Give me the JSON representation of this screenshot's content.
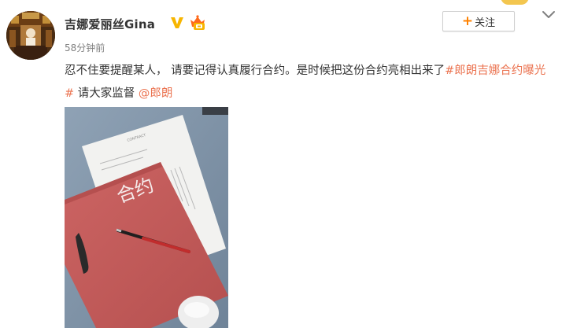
{
  "post": {
    "author": "吉娜爱丽丝Gina",
    "time": "58分钟前",
    "follow_label": "关注",
    "follow_plus": "+",
    "text_before": "忍不住要提醒某人，  请要记得认真履行合约。是时候把这份合约亮相出来了",
    "hashtag": "#郎朗吉娜合约曝光#",
    "text_middle": "  请大家监督  ",
    "mention": "@郎朗"
  },
  "image": {
    "folder_text": "合约",
    "paper_heading": "CONTRACT"
  },
  "icons": {
    "verified": "verified-v-icon",
    "member": "member-crown-icon",
    "chevron": "chevron-down-icon",
    "avatar": "user-avatar"
  },
  "colors": {
    "link": "#eb7350",
    "accent": "#ff8200",
    "verified": "#f7b500",
    "folder": "#c45b5a"
  }
}
